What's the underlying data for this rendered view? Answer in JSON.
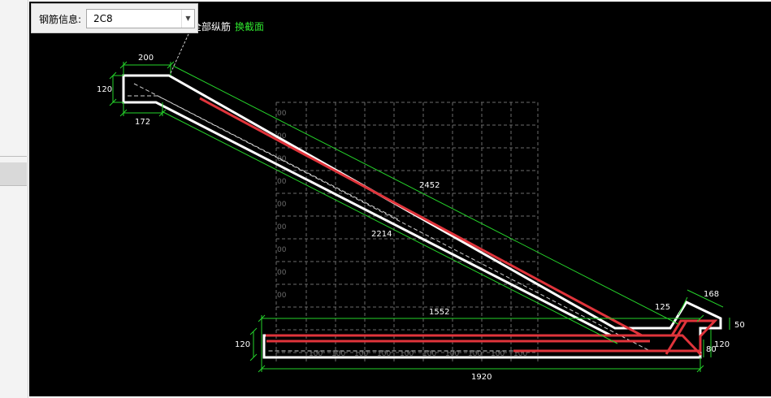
{
  "toolbar": {
    "rebar_info_label": "钢筋信息:",
    "rebar_info_value": "2C8",
    "partial_text": "全部纵筋",
    "link_text": "换截面"
  },
  "dimensions": {
    "top_width": "200",
    "left_height": "120",
    "top_lower": "172",
    "slope_upper": "2452",
    "slope_lower": "2214",
    "bottom_inner": "1552",
    "bottom_height": "120",
    "bottom_width": "1920",
    "right_slope": "125",
    "right_top": "168",
    "right_height": "50",
    "right_lower_height": "120",
    "right_small": "80"
  },
  "grid_labels": {
    "y_tick": "00",
    "x_tick": "100"
  },
  "colors": {
    "canvas_bg": "#000000",
    "outline": "#ffffff",
    "rebar": "#e0343b",
    "dimension": "#25d32a",
    "grid": "#6b6b6b",
    "link": "#2ee32e"
  }
}
